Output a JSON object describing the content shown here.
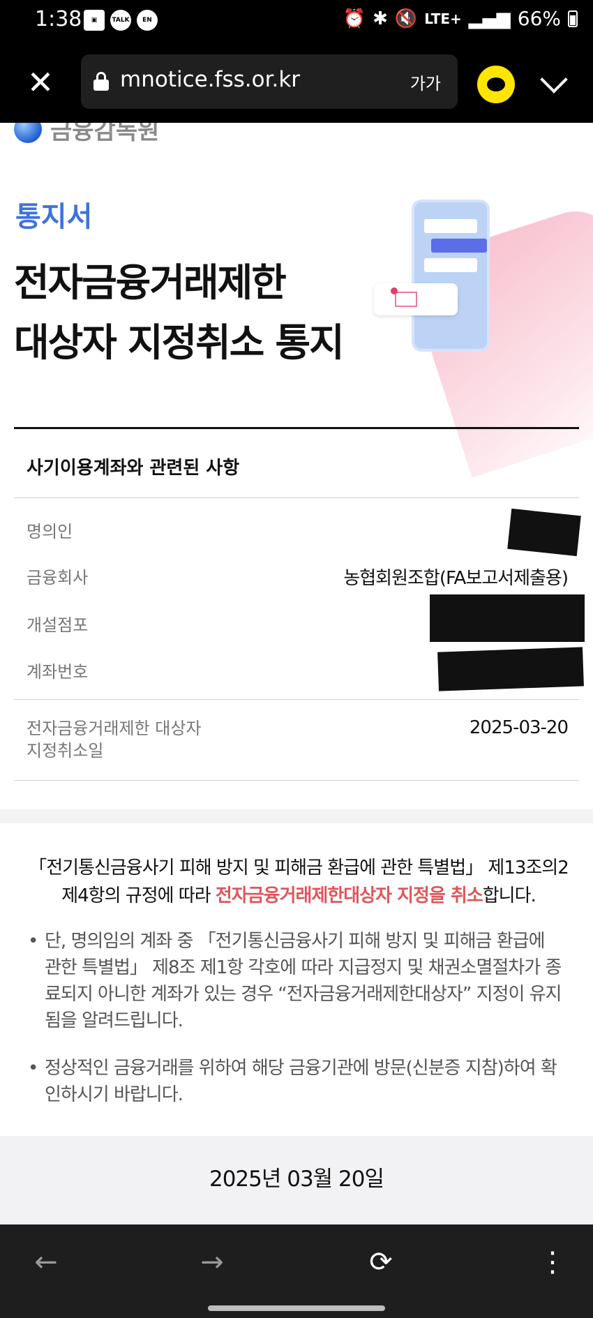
{
  "status_bar": {
    "time": "1:38",
    "left_icons": [
      "image-icon",
      "talk-icon",
      "en-icon"
    ],
    "talk_label": "TALK",
    "en_label": "EN",
    "network": "LTE+",
    "battery": "66%"
  },
  "browser": {
    "url": "mnotice.fss.or.kr",
    "text_size_label": "가가",
    "kakao_color": "#fee500"
  },
  "page": {
    "logo_text": "금융감독원",
    "notice_label": "통지서",
    "title_line1": "전자금융거래제한",
    "title_line2": "대상자 지정취소 통지",
    "section_title": "사기이용계좌와 관련된 사항",
    "rows": [
      {
        "label": "명의인",
        "value": ""
      },
      {
        "label": "금융회사",
        "value": "농협회원조합(FA보고서제출용)"
      },
      {
        "label": "개설점포",
        "value": ""
      },
      {
        "label": "계좌번호",
        "value": ""
      }
    ],
    "cancel_date_label_line1": "전자금융거래제한 대상자",
    "cancel_date_label_line2": "지정취소일",
    "cancel_date_value": "2025-03-20",
    "law_text_part1": "「전기통신금융사기 피해 방지 및 피해금 환급에 관한 특별법」 제13조의2 제4항의 규정에 따라 ",
    "law_text_emphasis": "전자금융거래제한대상자 지정을 취소",
    "law_text_part2": "합니다.",
    "bullet1": "단, 명의임의 계좌 중 「전기통신금융사기 피해 방지 및 피해금 환급에 관한 특별법」 제8조 제1항 각호에 따라 지급정지 및 채권소멸절차가 종료되지 아니한 계좌가 있는 경우 “전자금융거래제한대상자” 지정이 유지됨을 알려드립니다.",
    "bullet2": "정상적인 금융거래를 위하여 해당 금융기관에 방문(신분증 지참)하여 확인하시기 바랍니다.",
    "issue_date": "2025년 03월 20일",
    "accent_color": "#3f73d8",
    "emphasis_color": "#e0565b"
  },
  "nav": {
    "back": "←",
    "forward": "→",
    "reload": "⟳",
    "menu": "⋮"
  }
}
